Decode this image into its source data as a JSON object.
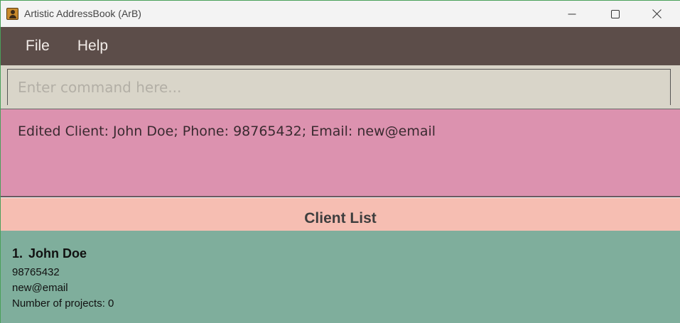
{
  "window": {
    "title": "Artistic AddressBook (ArB)"
  },
  "menu": {
    "items": [
      {
        "label": "File"
      },
      {
        "label": "Help"
      }
    ]
  },
  "command": {
    "placeholder": "Enter command here...",
    "value": ""
  },
  "result": {
    "text": "Edited Client: John Doe; Phone: 98765432; Email: new@email"
  },
  "client_list": {
    "title": "Client List",
    "clients": [
      {
        "index": "1.",
        "name": "John Doe",
        "phone": "98765432",
        "email": "new@email",
        "projects": "Number of projects: 0"
      }
    ]
  },
  "colors": {
    "menubar": "#5c4d49",
    "command_bg": "#d9d5c9",
    "result_bg": "#dc92af",
    "list_header_bg": "#f6beb2",
    "list_body_bg": "#7fae9c"
  },
  "icons": {
    "app": "addressbook-icon",
    "minimize": "minimize-icon",
    "maximize": "maximize-icon",
    "close": "close-icon"
  }
}
